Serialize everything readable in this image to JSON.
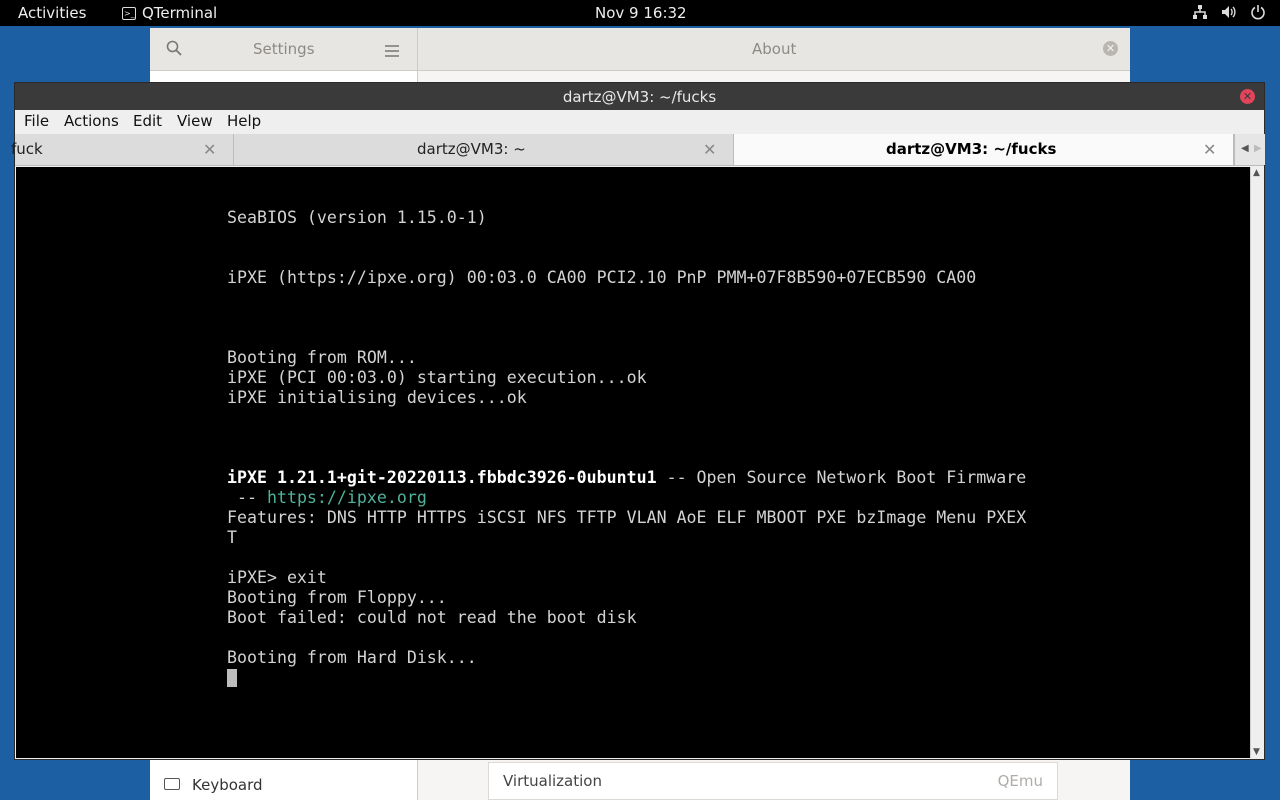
{
  "topbar": {
    "activities": "Activities",
    "app_name": "QTerminal",
    "clock": "Nov 9  16:32",
    "tray_icons": [
      "network-icon",
      "volume-icon",
      "power-icon"
    ]
  },
  "settings": {
    "title": "Settings",
    "about": "About",
    "sidebar_bottom_item": "Keyboard",
    "row_label": "Virtualization",
    "row_value": "QEmu"
  },
  "terminal": {
    "window_title": "dartz@VM3: ~/fucks",
    "menu": [
      "File",
      "Actions",
      "Edit",
      "View",
      "Help"
    ],
    "tabs": [
      {
        "label": "fuck",
        "active": false
      },
      {
        "label": "dartz@VM3: ~",
        "active": false
      },
      {
        "label": "dartz@VM3: ~/fucks",
        "active": true
      }
    ],
    "lines": {
      "l1": "SeaBIOS (version 1.15.0-1)",
      "l2": "iPXE (https://ipxe.org) 00:03.0 CA00 PCI2.10 PnP PMM+07F8B590+07ECB590 CA00",
      "l3": "Booting from ROM...",
      "l4": "iPXE (PCI 00:03.0) starting execution...ok",
      "l5": "iPXE initialising devices...ok",
      "l6_bold": "iPXE 1.21.1+git-20220113.fbbdc3926-0ubuntu1",
      "l6_rest": " -- Open Source Network Boot Firmware",
      "l7_prefix": " -- ",
      "l7_link": "https://ipxe.org",
      "l8": "Features: DNS HTTP HTTPS iSCSI NFS TFTP VLAN AoE ELF MBOOT PXE bzImage Menu PXEX",
      "l9": "T",
      "l10": "iPXE> exit",
      "l11": "Booting from Floppy...",
      "l12": "Boot failed: could not read the boot disk",
      "l13": "Booting from Hard Disk..."
    }
  },
  "colors": {
    "desktop": "#1d5fa3",
    "console_bg": "#000000",
    "console_text": "#d3d3d3",
    "link": "#4fb39b",
    "close_button": "#e0455a"
  }
}
